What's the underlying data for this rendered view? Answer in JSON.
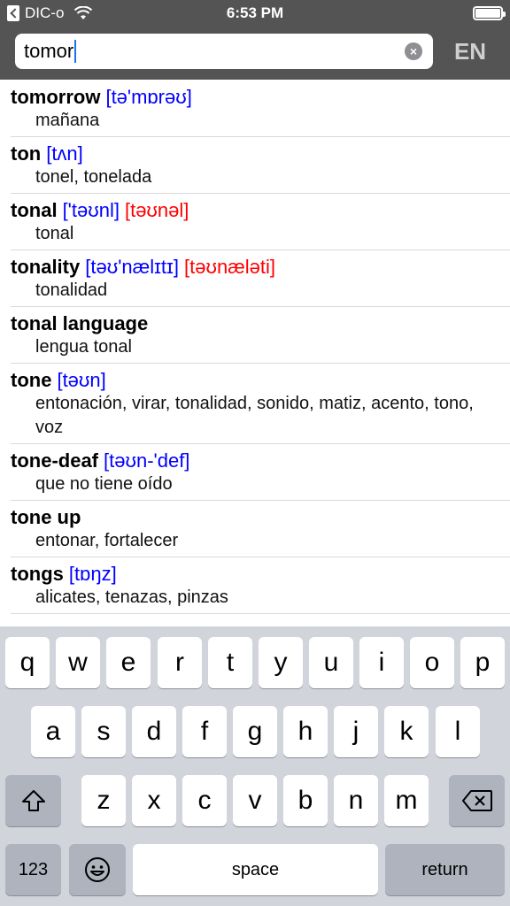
{
  "status_bar": {
    "carrier": "DIC-o",
    "time": "6:53 PM"
  },
  "search": {
    "value": "tomor",
    "clear_icon": "clear-circle-icon",
    "lang_label": "EN"
  },
  "results": [
    {
      "term": "tomorrow",
      "pron_us": "[tə'mɒrəʊ]",
      "pron_uk": "",
      "translation": "mañana"
    },
    {
      "term": "ton",
      "pron_us": "[tʌn]",
      "pron_uk": "",
      "translation": "tonel, tonelada"
    },
    {
      "term": "tonal",
      "pron_us": "['təʊnl]",
      "pron_uk": "[təʊnəl]",
      "translation": "tonal"
    },
    {
      "term": "tonality",
      "pron_us": "[təʊ'nælɪtɪ]",
      "pron_uk": "[təʊnæləti]",
      "translation": "tonalidad"
    },
    {
      "term": "tonal language",
      "pron_us": "",
      "pron_uk": "",
      "translation": "lengua tonal"
    },
    {
      "term": "tone",
      "pron_us": "[təʊn]",
      "pron_uk": "",
      "translation": "entonación, virar, tonalidad, sonido, matiz, acento, tono, voz"
    },
    {
      "term": "tone-deaf",
      "pron_us": "[təʊn-'def]",
      "pron_uk": "",
      "translation": "que no tiene oído"
    },
    {
      "term": "tone up",
      "pron_us": "",
      "pron_uk": "",
      "translation": "entonar, fortalecer"
    },
    {
      "term": "tongs",
      "pron_us": "[tɒŋz]",
      "pron_uk": "",
      "translation": "alicates, tenazas, pinzas"
    }
  ],
  "keyboard": {
    "row1": [
      "q",
      "w",
      "e",
      "r",
      "t",
      "y",
      "u",
      "i",
      "o",
      "p"
    ],
    "row2": [
      "a",
      "s",
      "d",
      "f",
      "g",
      "h",
      "j",
      "k",
      "l"
    ],
    "row3": [
      "z",
      "x",
      "c",
      "v",
      "b",
      "n",
      "m"
    ],
    "numbers_label": "123",
    "space_label": "space",
    "return_label": "return",
    "shift_icon": "shift-arrow-icon",
    "delete_icon": "backspace-icon",
    "emoji_icon": "emoji-smiley-icon"
  }
}
